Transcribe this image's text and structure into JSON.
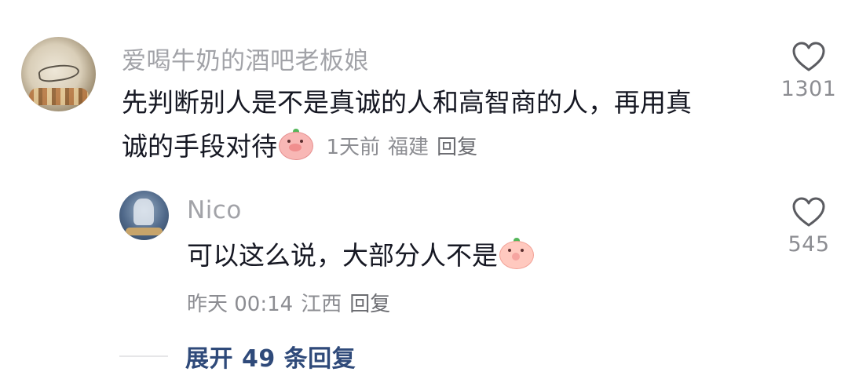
{
  "comments": [
    {
      "username": "爱喝牛奶的酒吧老板娘",
      "text_line1": "先判断别人是不是真诚的人和高智商的人，再用真",
      "text_line2": "诚的手段对待",
      "emoji": "pig-face-emoji",
      "time": "1天前",
      "location": "福建",
      "reply_label": "回复",
      "like_count": "1301"
    }
  ],
  "reply": {
    "username": "Nico",
    "text": "可以这么说，大部分人不是",
    "emoji": "peach-face-emoji",
    "time": "昨天 00:14",
    "location": "江西",
    "reply_label": "回复",
    "like_count": "545"
  },
  "expand": {
    "label": "展开 49 条回复"
  },
  "colors": {
    "username": "#a2a3a8",
    "body_text": "#161823",
    "meta": "#8c8d92",
    "expand_link": "#2f4a7a"
  }
}
